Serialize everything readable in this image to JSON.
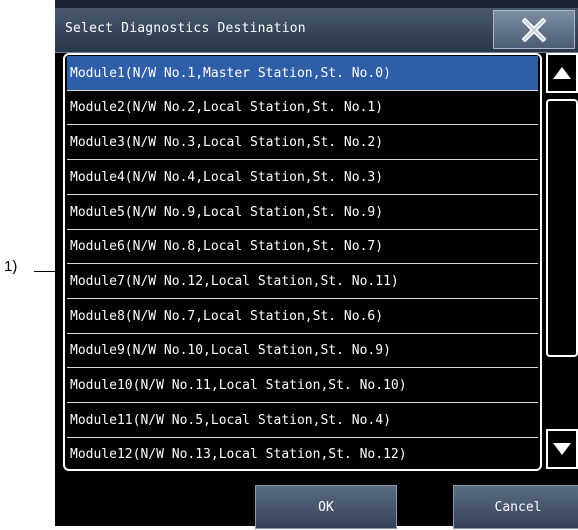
{
  "callout": {
    "label": "1)"
  },
  "dialog": {
    "title": "Select Diagnostics Destination",
    "close_icon": "close-x-icon",
    "selected_index": 0,
    "items": [
      "Module1(N/W No.1,Master Station,St. No.0)",
      "Module2(N/W No.2,Local Station,St. No.1)",
      "Module3(N/W No.3,Local Station,St. No.2)",
      "Module4(N/W No.4,Local Station,St. No.3)",
      "Module5(N/W No.9,Local Station,St. No.9)",
      "Module6(N/W No.8,Local Station,St. No.7)",
      "Module7(N/W No.12,Local Station,St. No.11)",
      "Module8(N/W No.7,Local Station,St. No.6)",
      "Module9(N/W No.10,Local Station,St. No.9)",
      "Module10(N/W No.11,Local Station,St. No.10)",
      "Module11(N/W No.5,Local Station,St. No.4)",
      "Module12(N/W No.13,Local Station,St. No.12)"
    ],
    "scroll_up_icon": "triangle-up-icon",
    "scroll_down_icon": "triangle-down-icon",
    "ok_label": "OK",
    "cancel_label": "Cancel"
  },
  "colors": {
    "background": "#000000",
    "selected_row": "#2f5ea8",
    "titlebar": "#37465a",
    "text": "#ffffff"
  }
}
